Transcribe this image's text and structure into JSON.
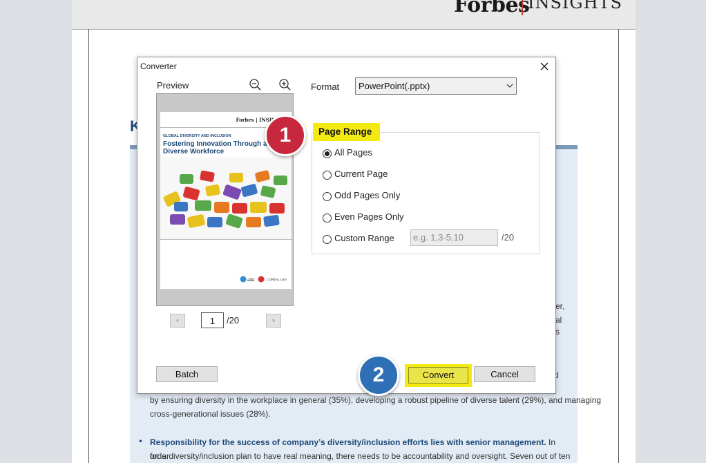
{
  "background_doc": {
    "brand": "Forbes",
    "brand_sub": "INSIGHTS",
    "heading_fragment": "K",
    "right_fragments": [
      "er,",
      "al",
      "s"
    ],
    "convert_side_fragment": "d",
    "para_line1": "by ensuring diversity in the workplace in general (35%), developing a robust pipeline of diverse talent (29%), and managing",
    "para_line2": "cross-generational issues (28%).",
    "bullet_heading": "Responsibility for the success of company’s diversity/inclusion efforts lies with senior management.",
    "bullet_text_a": " In order",
    "bullet_line2": "for a diversity/inclusion plan to have real meaning, there needs to be accountability and oversight. Seven out of ten"
  },
  "dialog": {
    "title": "Converter",
    "preview_label": "Preview",
    "thumbnail": {
      "brand": "Forbes | INSIGHTS",
      "kicker": "GLOBAL DIVERSITY AND INCLUSION",
      "title": "Fostering Innovation Through a Diverse Workforce",
      "sponsors": [
        "at&t",
        "L'ORÉAL USA"
      ]
    },
    "page_input": "1",
    "page_total": "/20",
    "format_label": "Format",
    "format_value": "PowerPoint(.pptx)",
    "page_range_label": "Page Range",
    "range_options": [
      {
        "label": "All Pages",
        "checked": true
      },
      {
        "label": "Current Page",
        "checked": false
      },
      {
        "label": "Odd Pages Only",
        "checked": false
      },
      {
        "label": "Even Pages Only",
        "checked": false
      },
      {
        "label": "Custom Range",
        "checked": false
      }
    ],
    "custom_placeholder": "e.g. 1,3-5,10",
    "custom_total": "/20",
    "batch_label": "Batch",
    "convert_label": "Convert",
    "cancel_label": "Cancel"
  },
  "badges": {
    "step1": "1",
    "step2": "2"
  },
  "colors": {
    "highlight": "#f3ea12",
    "badge1": "#c8283e",
    "badge2": "#2f6fb5",
    "doc_blue": "#1d4a7a"
  }
}
